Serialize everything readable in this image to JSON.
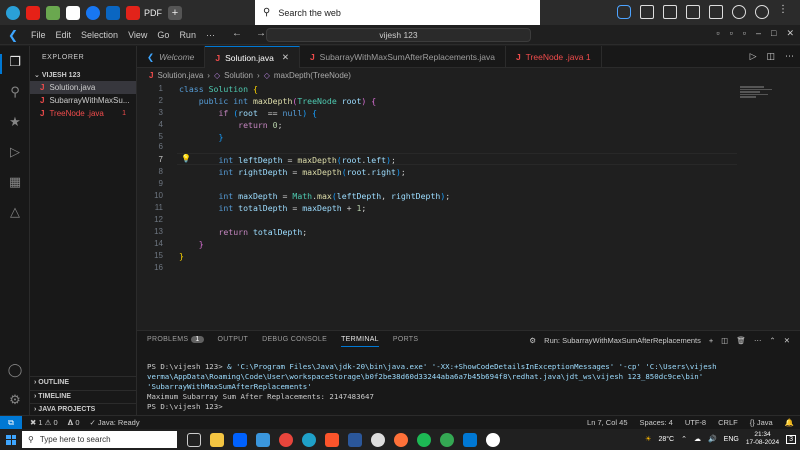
{
  "topbar": {
    "pdf_label": "PDF",
    "search_placeholder": "Search the web"
  },
  "titlebar": {
    "menu": [
      "File",
      "Edit",
      "Selection",
      "View",
      "Go",
      "Run",
      "···"
    ],
    "command_center": "vijesh 123"
  },
  "sidebar": {
    "title": "EXPLORER",
    "folder": "VIJESH 123",
    "files": [
      {
        "name": "Solution.java"
      },
      {
        "name": "SubarrayWithMaxSu..."
      },
      {
        "name": "TreeNode .java",
        "count": "1"
      }
    ],
    "outline": "OUTLINE",
    "timeline": "TIMELINE",
    "java_projects": "JAVA PROJECTS"
  },
  "tabs": [
    {
      "label": "Welcome"
    },
    {
      "label": "Solution.java"
    },
    {
      "label": "SubarrayWithMaxSumAfterReplacements.java"
    },
    {
      "label": "TreeNode .java 1"
    }
  ],
  "breadcrumb": {
    "file": "Solution.java",
    "class": "Solution",
    "method": "maxDepth(TreeNode)"
  },
  "editor": {
    "line_numbers": [
      "1",
      "2",
      "3",
      "4",
      "5",
      "6",
      "7",
      "8",
      "9",
      "10",
      "11",
      "12",
      "13",
      "14",
      "15",
      "16"
    ]
  },
  "panel": {
    "tabs": [
      "PROBLEMS",
      "OUTPUT",
      "DEBUG CONSOLE",
      "TERMINAL",
      "PORTS"
    ],
    "problems_count": "1",
    "run_label": "Run: SubarrayWithMaxSumAfterReplacements",
    "terminal": {
      "prompt1": "PS D:\\vijesh 123> ",
      "cmd": "& 'C:\\Program Files\\Java\\jdk-20\\bin\\java.exe' '-XX:+ShowCodeDetailsInExceptionMessages' '-cp' 'C:\\Users\\vijesh verma\\AppData\\Roaming\\Code\\User\\workspaceStorage\\b0f2be38d60d33244aba6a7b45b694f8\\redhat.java\\jdt_ws\\vijesh 123_850dc9ce\\bin' 'SubarrayWithMaxSumAfterReplacements'",
      "output": "Maximum Subarray Sum After Replacements: 2147483647",
      "prompt2": "PS D:\\vijesh 123> "
    }
  },
  "statusbar": {
    "errors": "1",
    "warnings": "0",
    "ports": "0",
    "java": "Java: Ready",
    "position": "Ln 7, Col 45",
    "spaces": "Spaces: 4",
    "encoding": "UTF-8",
    "eol": "CRLF",
    "language": "Java"
  },
  "taskbar": {
    "search_placeholder": "Type here to search",
    "weather": "28°C",
    "lang": "ENG",
    "time": "21:34",
    "date": "17-08-2024",
    "notifications": "3"
  }
}
